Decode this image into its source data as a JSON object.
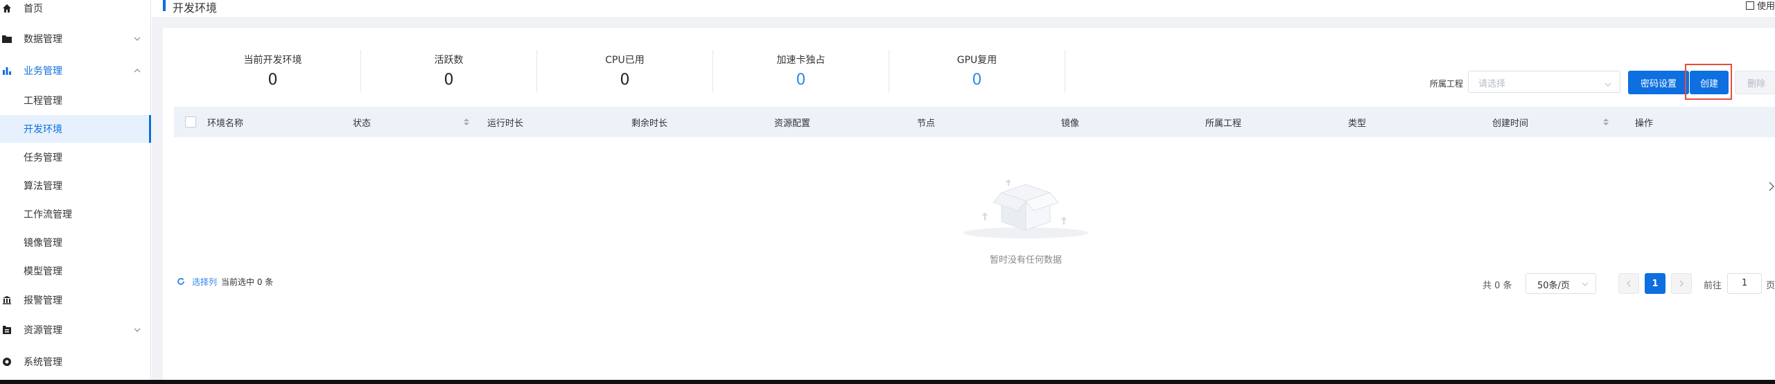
{
  "sidebar": {
    "items": [
      {
        "label": "首页",
        "icon": "home-icon"
      },
      {
        "label": "数据管理",
        "icon": "folder-icon",
        "expandable": true
      },
      {
        "label": "业务管理",
        "icon": "chart-icon",
        "expandable": true,
        "expanded": true
      },
      {
        "label": "报警管理",
        "icon": "bank-icon"
      },
      {
        "label": "资源管理",
        "icon": "resource-icon",
        "expandable": true
      },
      {
        "label": "系统管理",
        "icon": "system-icon"
      }
    ],
    "business_sub": [
      {
        "label": "工程管理"
      },
      {
        "label": "开发环境",
        "active": true
      },
      {
        "label": "任务管理"
      },
      {
        "label": "算法管理"
      },
      {
        "label": "工作流管理"
      },
      {
        "label": "镜像管理"
      },
      {
        "label": "模型管理"
      }
    ]
  },
  "header": {
    "title": "开发环境",
    "help_label": "使用"
  },
  "stats": [
    {
      "label": "当前开发环境",
      "value": "0"
    },
    {
      "label": "活跃数",
      "value": "0"
    },
    {
      "label": "CPU已用",
      "value": "0"
    },
    {
      "label": "加速卡独占",
      "value": "0",
      "highlight": true
    },
    {
      "label": "GPU复用",
      "value": "0",
      "highlight": true
    }
  ],
  "filters": {
    "project_label": "所属工程",
    "project_placeholder": "请选择"
  },
  "actions": {
    "password_label": "密码设置",
    "create_label": "创建",
    "delete_label": "删除"
  },
  "table": {
    "columns": [
      {
        "label": "环境名称"
      },
      {
        "label": "状态",
        "sortable": true
      },
      {
        "label": "运行时长"
      },
      {
        "label": "剩余时长"
      },
      {
        "label": "资源配置"
      },
      {
        "label": "节点"
      },
      {
        "label": "镜像"
      },
      {
        "label": "所属工程"
      },
      {
        "label": "类型"
      },
      {
        "label": "创建时间",
        "sortable": true
      },
      {
        "label": "操作"
      }
    ],
    "rows": [],
    "empty_text": "暂时没有任何数据"
  },
  "footer": {
    "select_cols_label": "选择列",
    "selected_text": "当前选中 0 条",
    "total_text": "共 0 条",
    "page_size": "50条/页",
    "current_page": "1",
    "goto_label": "前往",
    "goto_value": "1",
    "page_unit": "页"
  },
  "colors": {
    "primary": "#0d6fe0",
    "highlight_value": "#2f86eb",
    "create_outline": "#e74c3c",
    "page_bg": "#f0f2f5"
  }
}
